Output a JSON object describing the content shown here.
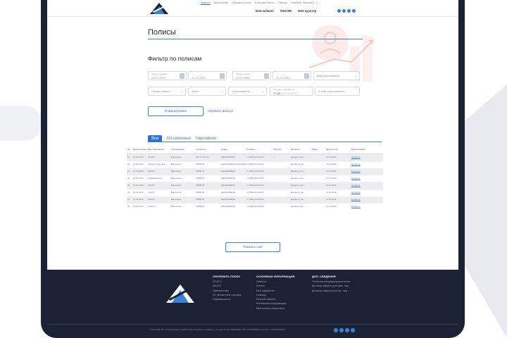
{
  "header": {
    "top_nav": [
      "Новости",
      "Мой кабинет",
      "Оформить полис",
      "Бонусные баллы",
      "Помощь",
      "Инженер, Пирогов А. А."
    ],
    "sub_nav": [
      "Мой кабинет",
      "Мой ВВ",
      "Мой куратор"
    ]
  },
  "page": {
    "title": "Полисы"
  },
  "filter": {
    "title": "Фильтр по полисам",
    "date_from_label": "Период создания",
    "date_from_1": "01.01.2019",
    "date_from_2": "31.01.2019",
    "date_to_label": "Период оплаты",
    "date_to_1": "01.01.2019",
    "date_to_2": "31.01.2019",
    "insurance_type": "Вид страхования",
    "policy_number": "Номер полиса",
    "agent": "Агент",
    "insurer": "Страхователь",
    "phone_label": "Телефон страхователя",
    "phone_value": "+7 (9",
    "phone_rest": "11) 123-45-67",
    "email": "E-mail страхователя",
    "apply": "Отфильтровать",
    "reset": "Сбросить фильтр"
  },
  "tabs": [
    "Все",
    "Оплаченные",
    "Черновики"
  ],
  "table": {
    "headers": [
      "№",
      "Дата создания",
      "Вид страхования",
      "Страхователь",
      "Стоимость",
      "Номер",
      "Телефон",
      "Продлён",
      "Документ",
      "Прим.",
      "Дата оплаты",
      "Редактировать"
    ],
    "rows": [
      [
        "01",
        "01.01.2019",
        "ОСАГО",
        "Ванечкина",
        "РМ УЧ.ОЗ.О р.",
        "ЦЕЖКАЗЛЕЛЕ",
        "+7 (950) 123-45-67",
        "",
        "Документ_№...",
        "",
        "12.12.2019",
        "Оплатить"
      ],
      [
        "02",
        "01.01.2019",
        "Жизнь и здоровье",
        "Ванечкина",
        "33880.00",
        "ЦЕЖКАЗЛЕЛЕ ЖЛЖЛЕЛЕЛЕ",
        "+7 (950) 123-45-67",
        "",
        "Документ_№...",
        "",
        "12.12.2019",
        "Оплатить"
      ],
      [
        "03",
        "01.01.2019",
        "КАСКО",
        "Ванечкина",
        "33880.00",
        "ЦЕЖКАЗЛЕЛЕ",
        "+7 (950) 123-45-67",
        "",
        "Документ_№...",
        "",
        "12.12.2019",
        "Оплатить"
      ],
      [
        "04",
        "01.01.2019",
        "Недвижимость",
        "Ванечкина",
        "33880.00",
        "ЦЕЖКАЗЛЕЛЕ",
        "+7 (950) 123-45-67",
        "",
        "Документ_№...",
        "",
        "12.12.2019",
        "Оплатить"
      ],
      [
        "05",
        "01.01.2019",
        "ОСАГО",
        "Ванечкина",
        "33880.00",
        "ЦЕЖКАЗЛЕЛЕ",
        "+7 (950) 123-45-67",
        "",
        "Документ_№...",
        "",
        "12.12.2019",
        "Оплатить"
      ],
      [
        "06",
        "01.01.2019",
        "ОСАГО",
        "Ванечкина",
        "33880.00",
        "ЦЕЖКАЗЛЕЛЕ",
        "+7 (950) 123-45-67",
        "",
        "Документ_№...",
        "",
        "12.12.2019",
        "Оплатить"
      ],
      [
        "07",
        "01.01.2019",
        "ОСАГО",
        "Ванечкина",
        "33880.00",
        "ЦЕЖКАЗЛЕЛЕ",
        "+7 (950) 123-45-67",
        "",
        "Документ_№...",
        "",
        "12.12.2019",
        "Оплатить"
      ],
      [
        "08",
        "01.01.2019",
        "ОСАГО",
        "Ванечкина",
        "33880.00",
        "ЦЕЖКАЗЛЕЛЕ",
        "+7 (950) 123-45-67",
        "",
        "Документ_№...",
        "",
        "12.12.2019",
        "Оплатить"
      ]
    ],
    "more": "Показать ещё"
  },
  "footer": {
    "col1": {
      "title": "ОФОРМИТЬ ПОЛИС",
      "items": [
        "ОСАГО",
        "КАСКО",
        "Путешествия",
        "От несчастных случаев",
        "Недвижимость"
      ]
    },
    "col2": {
      "title": "ОСНОВНАЯ ИНФОРМАЦИЯ",
      "items": [
        "Новости",
        "Агенты",
        "Мои заработки",
        "Помощь",
        "Личный кабинет",
        "Контактная информация",
        "Мои полисы и выплаты"
      ]
    },
    "col3": {
      "title": "ДОП. СВЕДЕНИЯ",
      "items": [
        "Политика конфиденциальности",
        "Договор оферты для физ. лиц",
        "Договор оферты для юр. лиц"
      ]
    },
    "copyright": "© 2016-2019 ООО «Страховой дом»; 123456, Санкт-Петербург, ул. Марата, д. 46, офис 5; ИНН 7800000000; ОГРН 1117800000000; Телефон: +7 (800) 555-55-55"
  },
  "colors": {
    "accent": "#2f6fcf",
    "footer_bg": "#1b2233"
  }
}
